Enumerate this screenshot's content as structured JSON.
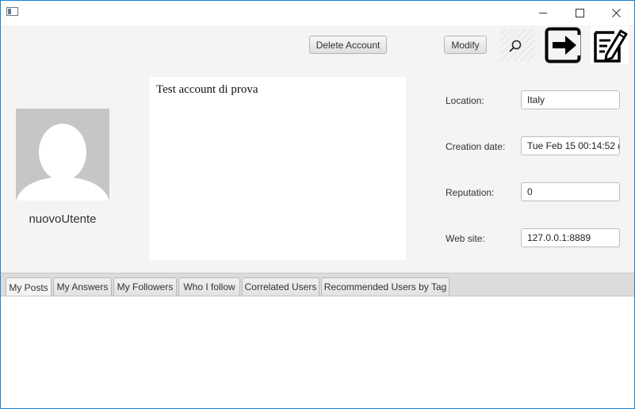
{
  "window": {
    "minimize_icon": "minimize-icon",
    "maximize_icon": "maximize-icon",
    "close_icon": "close-icon"
  },
  "toolbar": {
    "delete_label": "Delete Account",
    "modify_label": "Modify",
    "icons": [
      "search-icon",
      "logout-icon",
      "edit-profile-icon"
    ]
  },
  "profile": {
    "username": "nuovoUtente",
    "bio": "Test account di prova",
    "avatar_icon": "default-avatar-icon"
  },
  "details": {
    "location_label": "Location:",
    "location_value": "Italy",
    "creation_label": "Creation date:",
    "creation_value": "Tue Feb 15 00:14:52 (",
    "reputation_label": "Reputation:",
    "reputation_value": "0",
    "website_label": "Web site:",
    "website_value": "127.0.0.1:8889"
  },
  "tabs": [
    {
      "label": "My Posts",
      "active": true
    },
    {
      "label": "My Answers",
      "active": false
    },
    {
      "label": "My Followers",
      "active": false
    },
    {
      "label": "Who I follow",
      "active": false
    },
    {
      "label": "Correlated Users",
      "active": false
    },
    {
      "label": "Recommended Users by Tag",
      "active": false
    }
  ],
  "colors": {
    "window_border": "#1883d7",
    "background": "#f4f4f4",
    "avatar": "#c6c6c6"
  }
}
